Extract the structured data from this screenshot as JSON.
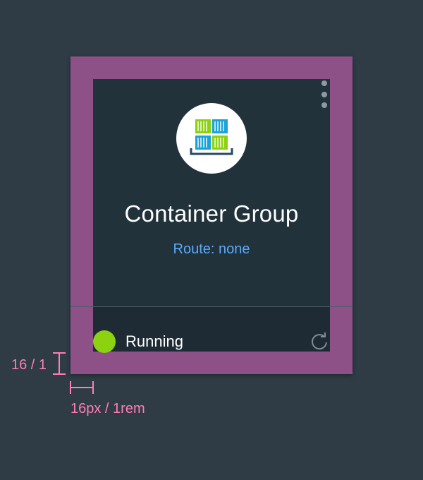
{
  "tile": {
    "title": "Container Group",
    "route": "Route: none",
    "status": "Running",
    "status_color": "#8cd211",
    "icon": "container-group-icon",
    "menu_icon": "overflow-menu-icon",
    "action_icon": "refresh-icon"
  },
  "annotations": {
    "vertical_padding": "16 / 1",
    "horizontal_padding": "16px / 1rem",
    "color": "#ff7eb6"
  },
  "colors": {
    "background": "#2f3c45",
    "padding_highlight": "#8d5087",
    "tile": "#22323b",
    "route_link": "#5aaafa"
  }
}
